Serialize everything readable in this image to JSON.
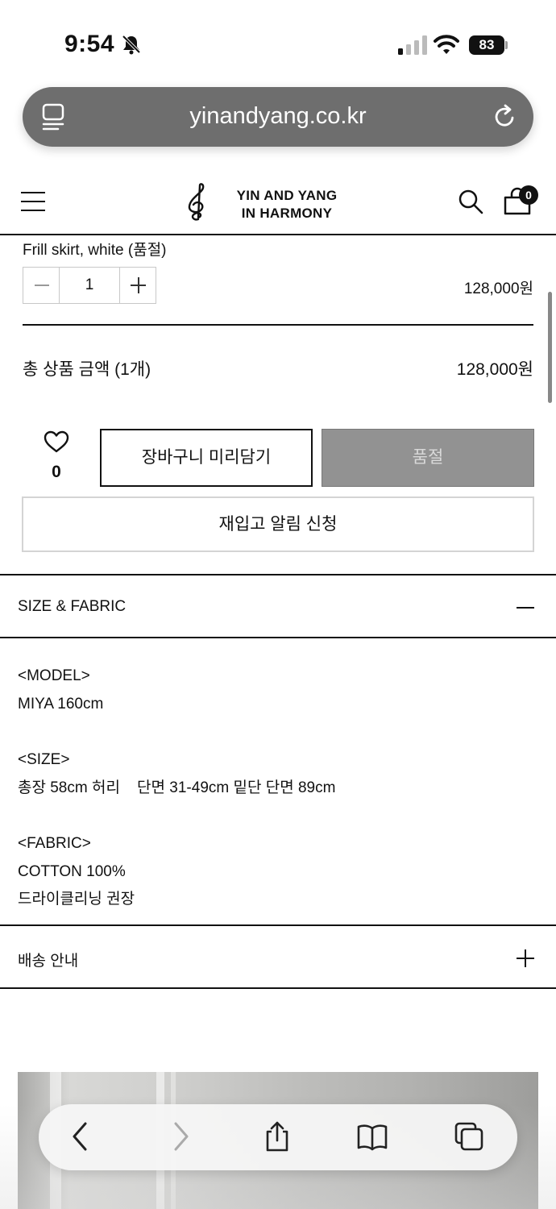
{
  "status_bar": {
    "time": "9:54",
    "battery": "83"
  },
  "browser": {
    "url": "yinandyang.co.kr"
  },
  "site": {
    "logo_line1": "YIN AND YANG",
    "logo_line2": "IN HARMONY",
    "cart_count": "0"
  },
  "option": {
    "name": "Frill skirt, white (품절)",
    "quantity": "1",
    "price": "128,000원"
  },
  "total": {
    "label": "총 상품 금액 (1개)",
    "value": "128,000원"
  },
  "actions": {
    "wish_count": "0",
    "cart_label": "장바구니 미리담기",
    "soldout_label": "품절",
    "restock_label": "재입고 알림 신청"
  },
  "size_fabric": {
    "title": "SIZE & FABRIC",
    "model_heading": "<MODEL>",
    "model_value": "MIYA 160cm",
    "size_heading": "<SIZE>",
    "size_value": "총장 58cm 허리    단면 31-49cm 밑단 단면 89cm",
    "fabric_heading": "<FABRIC>",
    "fabric_value": "COTTON 100%",
    "care_value": "드라이클리닝 권장"
  },
  "shipping": {
    "title": "배송 안내"
  },
  "icons": {
    "reader": "reader-icon",
    "reload": "reload-icon",
    "menu": "hamburger-menu-icon",
    "search": "search-icon",
    "cart": "shopping-bag-icon",
    "wish": "heart-icon",
    "back": "chevron-left-icon",
    "forward": "chevron-right-icon",
    "share": "share-icon",
    "bookmarks": "book-icon",
    "tabs": "tabs-icon"
  }
}
